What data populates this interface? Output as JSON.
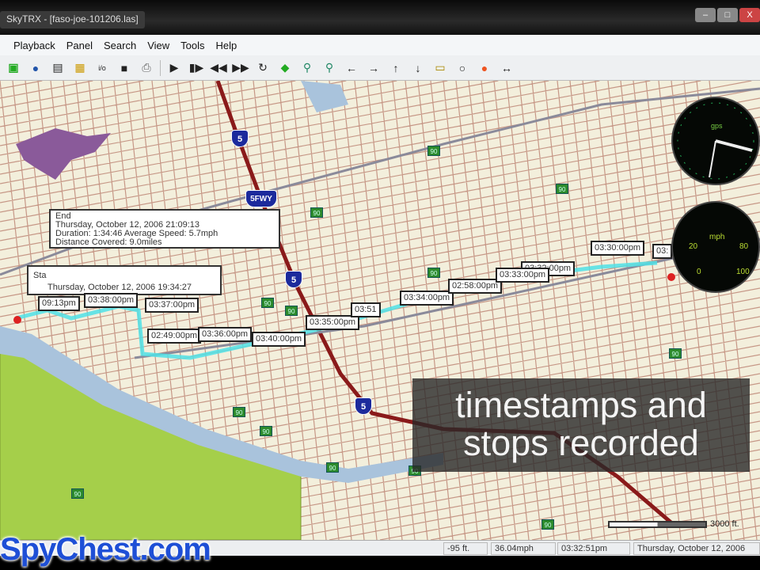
{
  "window": {
    "title": "SkyTRX - [faso-joe-101206.las]",
    "min": "–",
    "max": "□",
    "close": "X"
  },
  "menu": [
    "Playback",
    "Panel",
    "Search",
    "View",
    "Tools",
    "Help"
  ],
  "toolbar_icons": [
    "gps-icon",
    "globe-icon",
    "list-icon",
    "map-icon",
    "info-icon",
    "save-icon",
    "print-icon",
    "play-icon",
    "step-icon",
    "rewind-icon",
    "fast-forward-icon",
    "loop-icon",
    "usa-map-icon",
    "zoom-in-icon",
    "zoom-out-icon",
    "arrow-left-icon",
    "arrow-right-icon",
    "arrow-up-icon",
    "arrow-down-icon",
    "callout-icon",
    "circle-icon",
    "stop-icon",
    "measure-icon"
  ],
  "end_callout": {
    "l1": "End",
    "l2": "Thursday, October 12, 2006  21:09:13",
    "l3": "Duration: 1:34:46  Average Speed:   5.7mph",
    "l4": "Distance Covered:     9.0miles"
  },
  "start_callout": {
    "l1": "Sta",
    "l2": "Thursday, October 12, 2006  19:34:27"
  },
  "timestamps": [
    "09:13pm",
    "03:38:00pm",
    "03:37:00pm",
    "02:49:00pm",
    "03:36:00pm",
    "03:40:00pm",
    "03:35:00pm",
    "03:51",
    "03:34:00pm",
    "02:58:00pm",
    "03:33:00pm",
    "03:32:00pm",
    "03:30:00pm",
    "03:"
  ],
  "shields": {
    "i5": "5",
    "fwy": "5FWY",
    "rt": "90"
  },
  "gauges": {
    "speed_unit": "mph",
    "ticks": [
      "20",
      "80",
      "0",
      "100"
    ],
    "compass_label": "gps"
  },
  "caption": {
    "line1": "timestamps and",
    "line2": "stops recorded"
  },
  "scale": "3000 ft.",
  "status": {
    "elev": "-95 ft.",
    "speed": "36.04mph",
    "time": "03:32:51pm",
    "date": "Thursday, October 12, 2006"
  },
  "logo": "SpyChest.com"
}
